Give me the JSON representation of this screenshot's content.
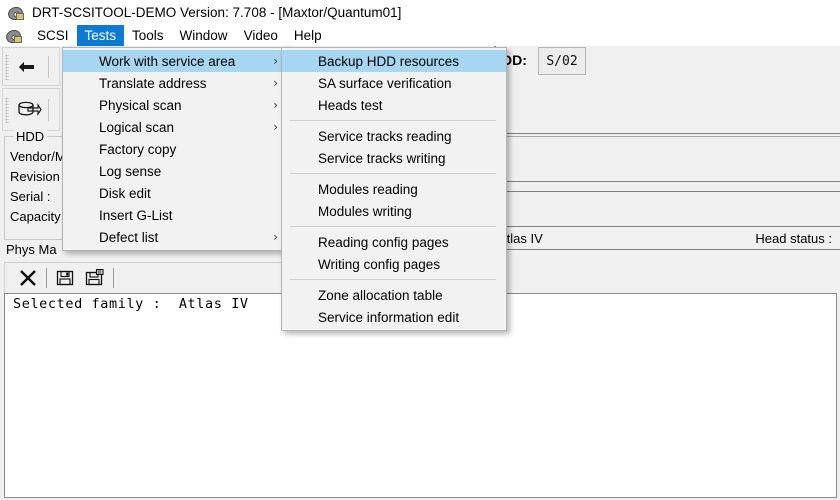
{
  "window": {
    "title": "DRT-SCSITOOL-DEMO Version: 7.708 - [Maxtor/Quantum01]",
    "icon": "app-disc-icon"
  },
  "menubar": {
    "items": [
      {
        "label": "SCSI",
        "active": false
      },
      {
        "label": "Tests",
        "active": true
      },
      {
        "label": "Tools",
        "active": false
      },
      {
        "label": "Window",
        "active": false
      },
      {
        "label": "Video",
        "active": false
      },
      {
        "label": "Help",
        "active": false
      }
    ],
    "active_color": "#0D7BD4"
  },
  "toolbar": {
    "row1": [
      {
        "icon": "swap-arrows-icon"
      }
    ],
    "row2": [
      {
        "icon": "drive-select-icon"
      }
    ]
  },
  "left_panel": {
    "group_legend": "HDD",
    "fields": [
      "Vendor/M",
      "Revision",
      "Serial :",
      "Capacity"
    ],
    "phys_map_label": "Phys Ma"
  },
  "right_panel": {
    "hdd_label": "DD:",
    "hdd_value": "S/02",
    "family_value": "Atlas IV",
    "head_status_label": "Head status :"
  },
  "log_toolbar": {
    "buttons": [
      {
        "icon": "clear-log-icon",
        "label": "X"
      },
      {
        "icon": "save-log-icon",
        "label": ""
      },
      {
        "icon": "save-log-as-icon",
        "label": ""
      }
    ]
  },
  "log": {
    "lines": [
      "Selected family :  Atlas IV"
    ]
  },
  "tests_menu": {
    "highlight_color": "#a7d6f2",
    "items": [
      {
        "label": "Work with service area",
        "submenu": true,
        "highlighted": true,
        "separator_after": false
      },
      {
        "label": "Translate address",
        "submenu": true,
        "highlighted": false,
        "separator_after": false
      },
      {
        "label": "Physical scan",
        "submenu": true,
        "highlighted": false,
        "separator_after": false
      },
      {
        "label": "Logical scan",
        "submenu": true,
        "highlighted": false,
        "separator_after": false
      },
      {
        "label": "Factory copy",
        "submenu": false,
        "highlighted": false,
        "separator_after": false
      },
      {
        "label": "Log sense",
        "submenu": false,
        "highlighted": false,
        "separator_after": false
      },
      {
        "label": "Disk edit",
        "submenu": false,
        "highlighted": false,
        "separator_after": false
      },
      {
        "label": "Insert G-List",
        "submenu": false,
        "highlighted": false,
        "separator_after": false
      },
      {
        "label": "Defect list",
        "submenu": true,
        "highlighted": false,
        "separator_after": false
      }
    ]
  },
  "service_area_submenu": {
    "items": [
      {
        "label": "Backup HDD resources",
        "highlighted": true,
        "separator_after": false
      },
      {
        "label": "SA surface verification",
        "highlighted": false,
        "separator_after": false
      },
      {
        "label": "Heads test",
        "highlighted": false,
        "separator_after": true
      },
      {
        "label": "Service tracks reading",
        "highlighted": false,
        "separator_after": false
      },
      {
        "label": "Service tracks writing",
        "highlighted": false,
        "separator_after": true
      },
      {
        "label": "Modules reading",
        "highlighted": false,
        "separator_after": false
      },
      {
        "label": "Modules writing",
        "highlighted": false,
        "separator_after": true
      },
      {
        "label": "Reading config pages",
        "highlighted": false,
        "separator_after": false
      },
      {
        "label": "Writing config pages",
        "highlighted": false,
        "separator_after": true
      },
      {
        "label": "Zone allocation table",
        "highlighted": false,
        "separator_after": false
      },
      {
        "label": "Service information edit",
        "highlighted": false,
        "separator_after": false
      }
    ]
  }
}
